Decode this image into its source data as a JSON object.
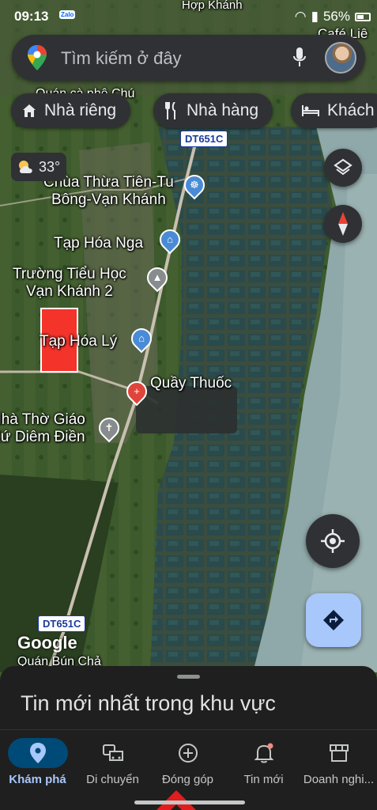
{
  "status_bar": {
    "time": "09:13",
    "notif_app": "Zalo",
    "battery": "56%"
  },
  "search": {
    "placeholder": "Tìm kiếm ở đây"
  },
  "chips": [
    {
      "label": "Nhà riêng",
      "icon": "home-icon"
    },
    {
      "label": "Nhà hàng",
      "icon": "restaurant-icon"
    },
    {
      "label": "Khách",
      "icon": "hotel-icon"
    }
  ],
  "weather": {
    "temp": "33°",
    "icon": "partly-cloudy-icon"
  },
  "map": {
    "labels": {
      "pagoda": "Chùa Thừa Tiên-Tu\nBông-Vạn Khánh",
      "store_nga": "Tạp Hóa Nga",
      "school": "Trường Tiểu Học\nVạn Khánh 2",
      "store_ly": "Tạp Hóa Lý",
      "pharmacy": "Quầy Thuốc",
      "church": "Nhà Thờ Giáo\nXứ Diêm Điền",
      "restaurant": "Quán Bún Chả",
      "cafe": "Café Liê",
      "top_label": "Hợp Khánh",
      "top_restaurant": "Quán cà phê Chú"
    },
    "road_shields": [
      "DT651C",
      "DT651C"
    ],
    "attribution": "Google"
  },
  "sheet": {
    "title": "Tin mới nhất trong khu vực"
  },
  "nav": [
    {
      "label": "Khám phá",
      "icon": "explore-pin-icon",
      "active": true
    },
    {
      "label": "Di chuyển",
      "icon": "commute-car-icon",
      "active": false
    },
    {
      "label": "Đóng góp",
      "icon": "contribute-plus-icon",
      "active": false
    },
    {
      "label": "Tin mới",
      "icon": "notifications-bell-icon",
      "active": false
    },
    {
      "label": "Doanh nghi...",
      "icon": "business-store-icon",
      "active": false
    }
  ],
  "colors": {
    "accent": "#a8c7fa",
    "surface": "#303134",
    "sheet": "#1f1f1f",
    "marker_red": "#f4332b"
  }
}
